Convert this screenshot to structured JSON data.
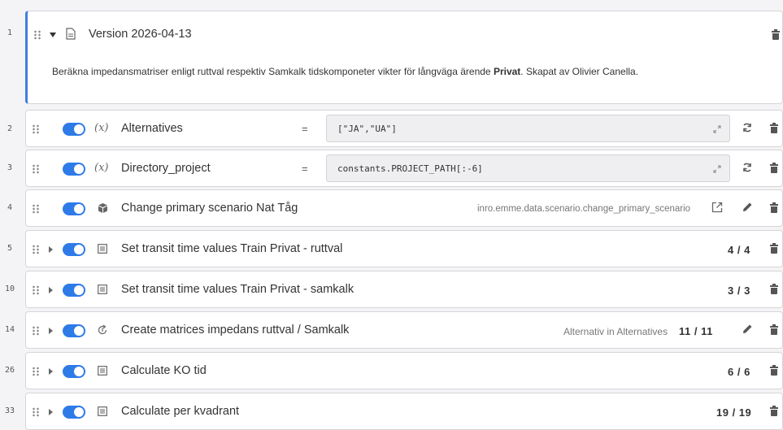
{
  "rows": [
    {
      "line": "1",
      "title": "Version 2026-04-13",
      "desc_prefix": "Beräkna impedansmatriser enligt ruttval respektiv Samkalk tidskomponeter vikter för långväga ärende ",
      "desc_bold": "Privat",
      "desc_suffix": ". Skapat av Olivier Canella."
    },
    {
      "line": "2",
      "type_icon": "(x)",
      "title": "Alternatives",
      "eq": "=",
      "value": "[\"JA\",\"UA\"]"
    },
    {
      "line": "3",
      "type_icon": "(x)",
      "title": "Directory_project",
      "eq": "=",
      "value": "constants.PROJECT_PATH[:-6]"
    },
    {
      "line": "4",
      "title": "Change primary scenario Nat Tåg",
      "tool": "inro.emme.data.scenario.change_primary_scenario"
    },
    {
      "line": "5",
      "title": "Set transit time values Train Privat - ruttval",
      "count": "4 / 4"
    },
    {
      "line": "10",
      "title": "Set transit time values Train Privat - samkalk",
      "count": "3 / 3"
    },
    {
      "line": "14",
      "title": "Create matrices impedans ruttval / Samkalk",
      "loop": "Alternativ in Alternatives",
      "count": "11 / 11"
    },
    {
      "line": "26",
      "title": "Calculate KO tid",
      "count": "6 / 6"
    },
    {
      "line": "33",
      "title": "Calculate per kvadrant",
      "count": "19 / 19"
    }
  ],
  "colors": {
    "accent": "#2e7be8",
    "border": "#3f7fdc"
  },
  "icons": [
    "drag-handle-icon",
    "collapse-icon",
    "expand-icon",
    "document-icon",
    "variable-icon",
    "tool-icon",
    "group-icon",
    "loop-icon",
    "expand-editor-icon",
    "refresh-icon",
    "open-external-icon",
    "edit-icon",
    "trash-icon"
  ]
}
